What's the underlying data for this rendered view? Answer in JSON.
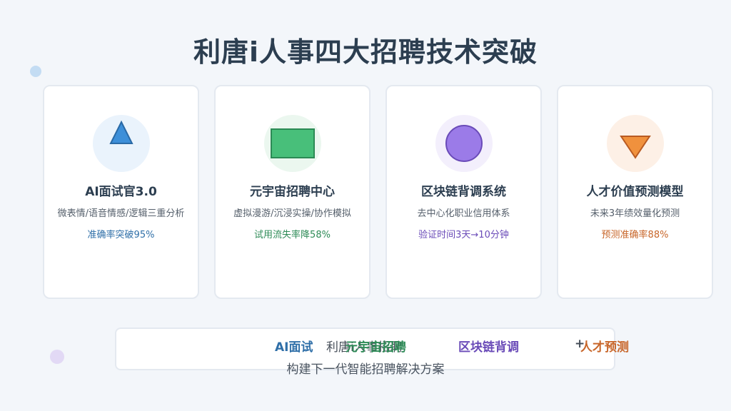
{
  "title": "利唐i人事四大招聘技术突破",
  "cards": [
    {
      "title": "AI面试官3.0",
      "desc": "微表情/语音情感/逻辑三重分析",
      "stat": "准确率突破95%",
      "icon": "triangle-icon",
      "accent": "#2f6fa8",
      "icon_color": "#3d8fd9",
      "circle_bg": "#eaf3fc"
    },
    {
      "title": "元宇宙招聘中心",
      "desc": "虚拟漫游/沉浸实操/协作模拟",
      "stat": "试用流失率降58%",
      "icon": "rectangle-icon",
      "accent": "#2e8b57",
      "icon_color": "#48bf7a",
      "circle_bg": "#ebf7ef"
    },
    {
      "title": "区块链背调系统",
      "desc": "去中心化职业信用体系",
      "stat": "验证时间3天→10分钟",
      "icon": "circle-icon",
      "accent": "#6a4bb8",
      "icon_color": "#9b7be8",
      "circle_bg": "#f3effc"
    },
    {
      "title": "人才价值预测模型",
      "desc": "未来3年绩效量化预测",
      "stat": "预测准确率88%",
      "icon": "down-triangle-icon",
      "accent": "#c8662a",
      "icon_color": "#f0913d",
      "circle_bg": "#fdf0e6"
    }
  ],
  "footer": {
    "item_ai": "AI面试",
    "item_mid": "利唐i人事招聘",
    "item_meta": "元宇宙招聘",
    "item_block": "区块链背调",
    "item_plus": "+",
    "item_talent": "人才预测",
    "subtitle": "构建下一代智能招聘解决方案"
  },
  "colors": {
    "ai": "#2f6fa8",
    "meta": "#2e8b57",
    "block": "#6a4bb8",
    "talent": "#c8662a"
  }
}
